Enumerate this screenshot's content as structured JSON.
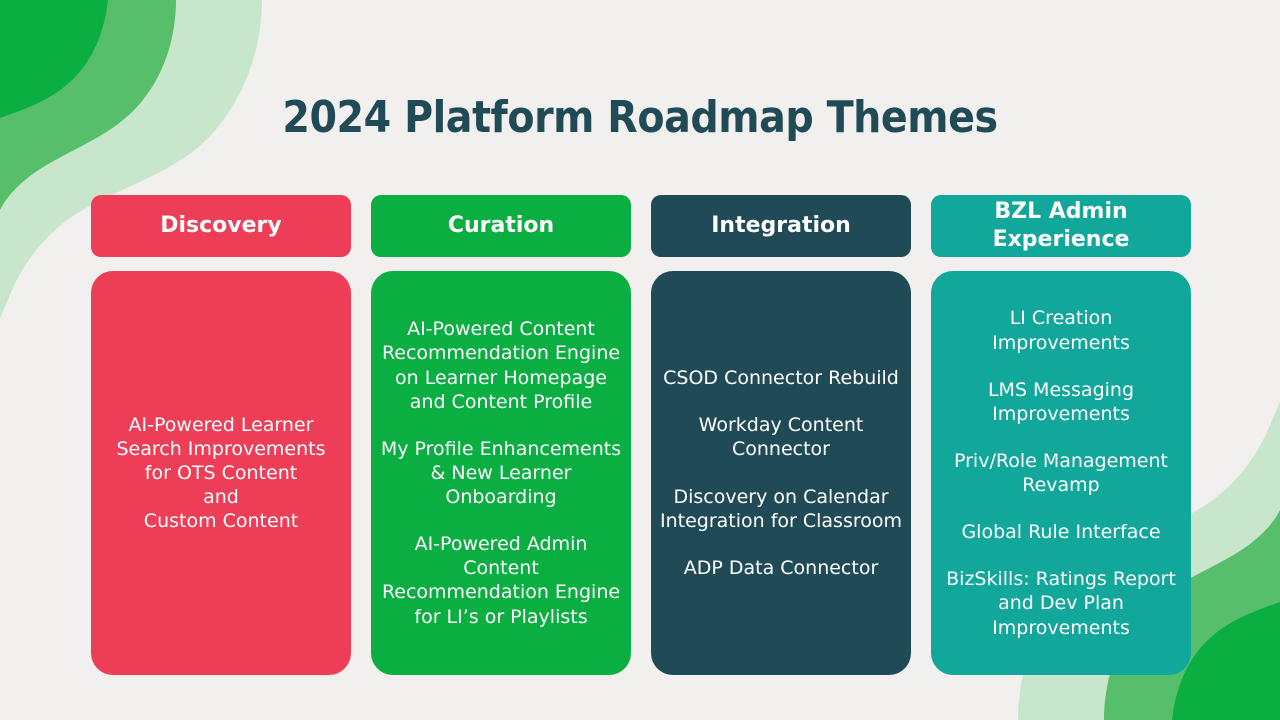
{
  "slide": {
    "title": "2024 Platform Roadmap Themes",
    "background_color": "#F1F0EF",
    "title_color": "#204B56"
  },
  "decor": {
    "wave_light": "#C8E6CC",
    "wave_medium": "#57BE6C",
    "wave_dark": "#0AAE41"
  },
  "columns": [
    {
      "header": "Discovery",
      "header_color": "#EE3E57",
      "body_color": "#EE3E57",
      "items": [
        "AI-Powered Learner\nSearch Improvements\nfor OTS Content\nand\nCustom Content"
      ]
    },
    {
      "header": "Curation",
      "header_color": "#0AAE41",
      "body_color": "#0AAE41",
      "items": [
        "AI-Powered Content Recommendation Engine on Learner Homepage and Content Profile",
        "My Profile Enhancements & New Learner Onboarding",
        "AI-Powered Admin Content Recommendation Engine for LI’s or Playlists"
      ]
    },
    {
      "header": "Integration",
      "header_color": "#204B56",
      "body_color": "#204B56",
      "items": [
        "CSOD Connector Rebuild",
        "Workday Content Connector",
        "Discovery on Calendar Integration for Classroom",
        "ADP Data Connector"
      ]
    },
    {
      "header": "BZL Admin Experience",
      "header_color": "#12A79B",
      "body_color": "#12A79B",
      "items": [
        "LI Creation Improvements",
        "LMS Messaging Improvements",
        "Priv/Role Management Revamp",
        "Global Rule Interface",
        "BizSkills: Ratings Report and Dev Plan Improvements"
      ]
    }
  ]
}
